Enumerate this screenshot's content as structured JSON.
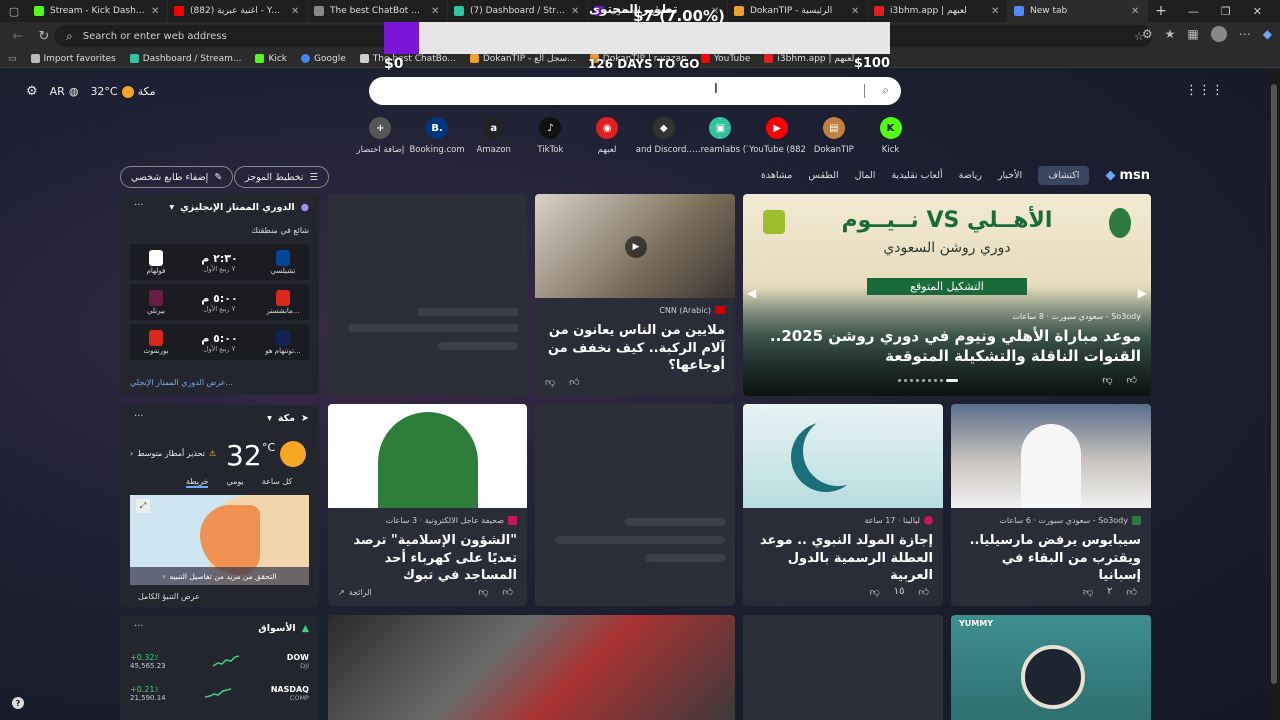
{
  "tabs": [
    {
      "label": "Stream - Kick Dashboard",
      "color": "#53fc18"
    },
    {
      "label": "(882) أغنية عبرية - YouTube",
      "color": "#ff0000"
    },
    {
      "label": "The best ChatBot and Widg",
      "color": "#888888"
    },
    {
      "label": "(7) Dashboard / Streamlabs",
      "color": "#31c3a2"
    },
    {
      "label": "تطوير المحتوى",
      "color": "#7b16d9"
    },
    {
      "label": "DokanTIP - الرئيسية",
      "color": "#f0a030"
    },
    {
      "label": "i3bhm.app | لعبهم",
      "color": "#e02020"
    },
    {
      "label": "New tab",
      "color": "#5588ff"
    }
  ],
  "address": {
    "placeholder": "Search or enter web address"
  },
  "bookmarks": [
    {
      "label": "Import favorites",
      "color": "#bbbbbb"
    },
    {
      "label": "Dashboard / Stream...",
      "color": "#31c3a2"
    },
    {
      "label": "Kick",
      "color": "#53fc18"
    },
    {
      "label": "Google",
      "color": "#4285f4"
    },
    {
      "label": "The best ChatBo...",
      "color": "#cccccc"
    },
    {
      "label": "DokanTIP - سجل الع...",
      "color": "#f0a030"
    },
    {
      "label": "DokanTIP | r-yazan",
      "color": "#f0a030"
    },
    {
      "label": "YouTube",
      "color": "#ff0000"
    },
    {
      "label": "i3bhm.app | لعبهم",
      "color": "#e02020"
    }
  ],
  "donation": {
    "title": "تطوير المحتوى",
    "amount": "$7 (7.00%)",
    "progress": 0.07,
    "min": "$0",
    "max": "$100",
    "days": "126 DAYS TO GO"
  },
  "ntp": {
    "lang": "AR",
    "temp_top": "32°C",
    "city": "مكة",
    "shortcuts": [
      {
        "label": "إضافة اختصار",
        "icon": "+",
        "color": "#555555"
      },
      {
        "label": "Booking.com",
        "icon": "B.",
        "color": "#003580"
      },
      {
        "label": "Amazon",
        "icon": "a",
        "color": "#222222"
      },
      {
        "label": "TikTok",
        "icon": "♪",
        "color": "#111111"
      },
      {
        "label": "لعبهم",
        "icon": "◉",
        "color": "#e02020"
      },
      {
        "label": "and Discord...",
        "icon": "◆",
        "color": "#333333"
      },
      {
        "label": "...reamlabs (7)",
        "icon": "▣",
        "color": "#31c3a2"
      },
      {
        "label": "YouTube (882)",
        "icon": "▶",
        "color": "#ff0000"
      },
      {
        "label": "DokanTIP",
        "icon": "▤",
        "color": "#c08040"
      },
      {
        "label": "Kick",
        "icon": "K",
        "color": "#53fc18"
      }
    ],
    "feed_btn_personalize": "إضفاء طابع شخصي",
    "feed_btn_layout": "تخطيط الموجز",
    "nav": [
      "اكتشاف",
      "الأخبار",
      "رياضة",
      "ألعاب تقليدية",
      "المال",
      "الطقس",
      "مشاهدة"
    ],
    "msn": "msn"
  },
  "sports": {
    "title": "الدوري الممتاز الإنجليزي",
    "trending": "شائع في منطقتك",
    "matches": [
      {
        "home": "تشيلسي",
        "away": "فولهام",
        "time": "٢:٣٠ م",
        "round": "٧ ربيع الأول",
        "home_color": "#034694",
        "away_color": "#ffffff"
      },
      {
        "home": "مانشستر...",
        "away": "بيرنلي",
        "time": "٥:٠٠ م",
        "round": "٧ ربيع الأول",
        "home_color": "#da291c",
        "away_color": "#6c1d45"
      },
      {
        "home": "توتنهام هو...",
        "away": "بورنموث",
        "time": "٥:٠٠ م",
        "round": "٧ ربيع الأول",
        "home_color": "#132257",
        "away_color": "#da291c"
      }
    ],
    "footer": "عرض الدوري الممتاز الإنجلي..."
  },
  "weather": {
    "city": "مكة",
    "alert": "تحذير أمطار متوسط",
    "temp": "32",
    "unit": "°C",
    "tabs": [
      "كل ساعة",
      "يومي",
      "خريطة"
    ],
    "cta": "التحقق من مزيد من تفاصيل التنبيه",
    "footer": "عرض التنبؤ الكامل"
  },
  "markets": {
    "title": "الأسواق",
    "rows": [
      {
        "name": "DOW",
        "sub": "DJI",
        "change": "+0.32٪",
        "value": "45,565.23"
      },
      {
        "name": "NASDAQ",
        "sub": "COMP",
        "change": "+0.21٪",
        "value": "21,590.14"
      }
    ]
  },
  "articles": {
    "hero": {
      "source": "So3ody - سعودي سبورت · 8 ساعات",
      "title": "موعد مباراة الأهلي ونيوم في دوري روشن 2025.. القنوات الناقلة والتشكيلة المتوقعة",
      "banner_title": "الأهــلي VS نــيــوم",
      "banner_sub": "دوري روشن السعودي",
      "banner_tag": "التشكيل المتوقع"
    },
    "knee": {
      "source": "CNN (Arabic)",
      "title": "ملايين من الناس يعانون من آلام الركبة.. كيف نخفف من أوجاعها؟"
    },
    "mosque": {
      "source": "صحيفة عاجل الالكترونية · 3 ساعات",
      "title": "\"الشؤون الإسلامية\" ترصد تعديًا على كهرباء أحد المساجد في تبوك",
      "trend": "الرائجة"
    },
    "mawlid": {
      "source": "ليالينا · 17 ساعة",
      "title": "إجازة المولد النبوي .. موعد العطلة الرسمية بالدول العربية",
      "count": "١٥"
    },
    "ceballos": {
      "source": "So3ody - سعودي سبورت · 6 ساعات",
      "title": "سيبايوس يرفض مارسيليا.. ويقترب من البقاء في إسبانيا",
      "count": "٢"
    },
    "food": {
      "label": "YUMMY"
    }
  }
}
